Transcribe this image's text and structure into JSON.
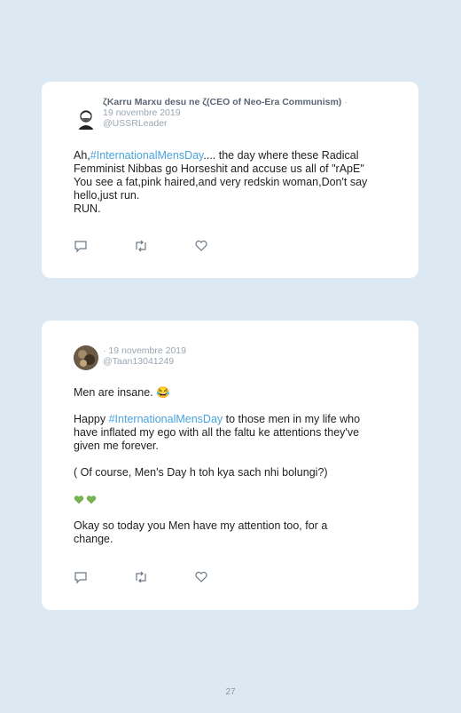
{
  "tweets": [
    {
      "display_name": "ζKarru Marxu desu ne ζ(CEO of Neo-Era Communism)",
      "separator": "·",
      "date": "19 novembre 2019",
      "handle": "@USSRLeader",
      "lines": [
        {
          "pre": "Ah,",
          "hashtag": "#InternationalMensDay",
          "post": ".... the day where these Radical"
        },
        {
          "text": "Femminist Nibbas go Horseshit and accuse us all of \"rApE\""
        },
        {
          "text": "You see a fat,pink haired,and very redskin woman,Don't say"
        },
        {
          "text": "hello,just run."
        },
        {
          "text": "RUN."
        }
      ],
      "actions": {
        "reply_icon": "reply-icon",
        "retweet_icon": "retweet-icon",
        "like_icon": "like-icon"
      }
    },
    {
      "display_name": "",
      "separator": "·",
      "date": "19 novembre 2019",
      "handle": "@Taan13041249",
      "line1": "Men are insane. 😂",
      "line2_pre": "Happy ",
      "line2_hashtag": "#InternationalMensDay",
      "line2_post": " to those men in my life who",
      "line3": "have inflated my ego with all the faltu ke attentions they've",
      "line4": "given me forever.",
      "line5": "( Of course, Men's Day h toh kya sach nhi bolungi?)",
      "hearts": [
        "green-heart-icon",
        "green-heart-icon"
      ],
      "line6": "Okay so today you Men have my attention too, for a",
      "line7": "change.",
      "actions": {
        "reply_icon": "reply-icon",
        "retweet_icon": "retweet-icon",
        "like_icon": "like-icon"
      }
    }
  ],
  "page_number": "27",
  "colors": {
    "background": "#dde9f2",
    "hashtag": "#4aa3df",
    "heart": "#77b255",
    "meta": "#9aa6b2"
  }
}
